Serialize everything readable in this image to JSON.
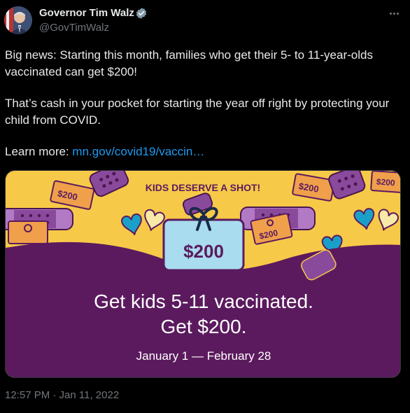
{
  "author": {
    "display_name": "Governor Tim Walz",
    "handle": "@GovTimWalz",
    "verified_color": "#1d9bf0"
  },
  "tweet": {
    "paragraph_1": "Big news: Starting this month, families who get their 5- to 11-year-olds vaccinated can get $200!",
    "paragraph_2": "That’s cash in your pocket for starting the year off right by protecting your child from COVID.",
    "learn_more_label": "Learn more:",
    "link_text": "mn.gov/covid19/vaccin…",
    "timestamp": "12:57 PM · Jan 11, 2022"
  },
  "media": {
    "banner": "KIDS DESERVE A SHOT!",
    "ticket_amount": "$200",
    "small_ticket_label": "$200",
    "headline_line1": "Get kids 5-11 vaccinated.",
    "headline_line2": "Get $200.",
    "date_range": "January 1 — February 28",
    "colors": {
      "yellow": "#f7c948",
      "purple": "#5b1a5e",
      "ticket_blue": "#a8dcee",
      "orange_ticket": "#f0a04b",
      "bandage_purple": "#8a4a9c",
      "heart_blue": "#1aa0c8"
    }
  },
  "icons": {
    "more": "more-horizontal-icon",
    "verified": "verified-badge-icon"
  }
}
